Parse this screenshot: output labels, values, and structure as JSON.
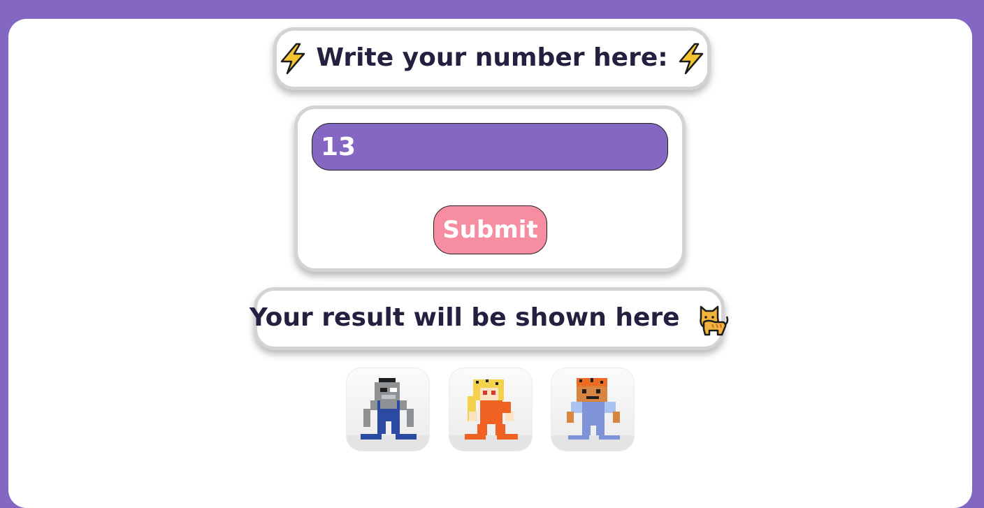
{
  "header": {
    "title": "Write your number here:",
    "left_icon": "lightning-bolt-icon",
    "right_icon": "lightning-bolt-icon"
  },
  "form": {
    "number_value": "13",
    "submit_label": "Submit"
  },
  "result": {
    "text": "Your result will be shown here",
    "icon": "cat-icon"
  },
  "avatars": [
    {
      "name": "grey-wolf-character"
    },
    {
      "name": "cheetah-character"
    },
    {
      "name": "tiger-character"
    }
  ],
  "colors": {
    "background": "#8466c3",
    "input": "#8466c3",
    "button": "#f78da0",
    "text": "#23213f"
  }
}
